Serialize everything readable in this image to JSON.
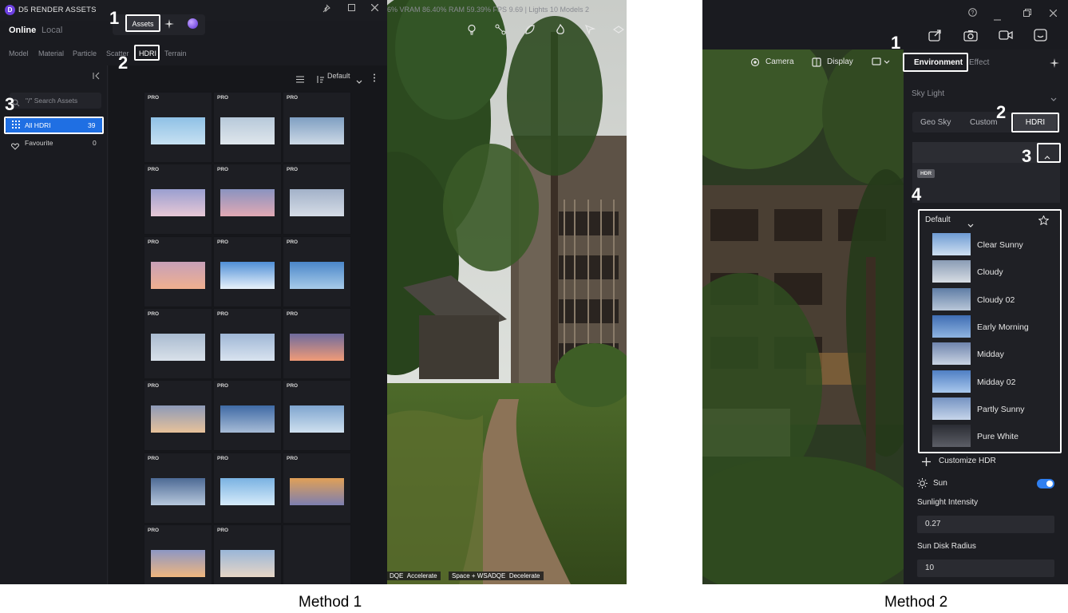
{
  "method1": {
    "window_title": "D5 RENDER ASSETS",
    "logo_letter": "D",
    "tabs": {
      "online": "Online",
      "local": "Local"
    },
    "top_buttons": {
      "assets": "Assets"
    },
    "categories": [
      "Model",
      "Material",
      "Particle",
      "Scatter",
      "HDRI",
      "Terrain"
    ],
    "search_placeholder": "\"/\" Search Assets",
    "sidebar": {
      "all_hdri": {
        "label": "All HDRI",
        "count": "39"
      },
      "favourite": {
        "label": "Favourite",
        "count": "0"
      }
    },
    "sort_label": "Default",
    "pro_badge": "PRO",
    "stats": "6%   VRAM 86.40%   RAM 59.39%   FPS 9.69   |   Lights 10   Models 2",
    "hints": {
      "k1": "DQE",
      "a1": "Accelerate",
      "k2": "Space + WSADQE",
      "a2": "Decelerate"
    },
    "markers": {
      "n1": "1",
      "n2": "2",
      "n3": "3"
    },
    "caption": "Method 1"
  },
  "method2": {
    "nav": {
      "camera": "Camera",
      "display": "Display"
    },
    "tabs": {
      "environment": "Environment",
      "effect": "Effect"
    },
    "sky_light": "Sky Light",
    "sky_modes": [
      "Geo Sky",
      "Custom",
      "HDRI"
    ],
    "hdr_badge": "HDR",
    "list_sort": "Default",
    "hdri_items": [
      "Clear Sunny",
      "Cloudy",
      "Cloudy 02",
      "Early Morning",
      "Midday",
      "Midday 02",
      "Partly Sunny",
      "Pure White"
    ],
    "customize": "Customize HDR",
    "sun": {
      "label": "Sun",
      "enabled": true
    },
    "sunlight_intensity": {
      "label": "Sunlight Intensity",
      "value": "0.27"
    },
    "sun_disk_radius": {
      "label": "Sun Disk Radius",
      "value": "10"
    },
    "markers": {
      "n1": "1",
      "n2": "2",
      "n3": "3",
      "n4": "4"
    },
    "caption": "Method 2"
  }
}
